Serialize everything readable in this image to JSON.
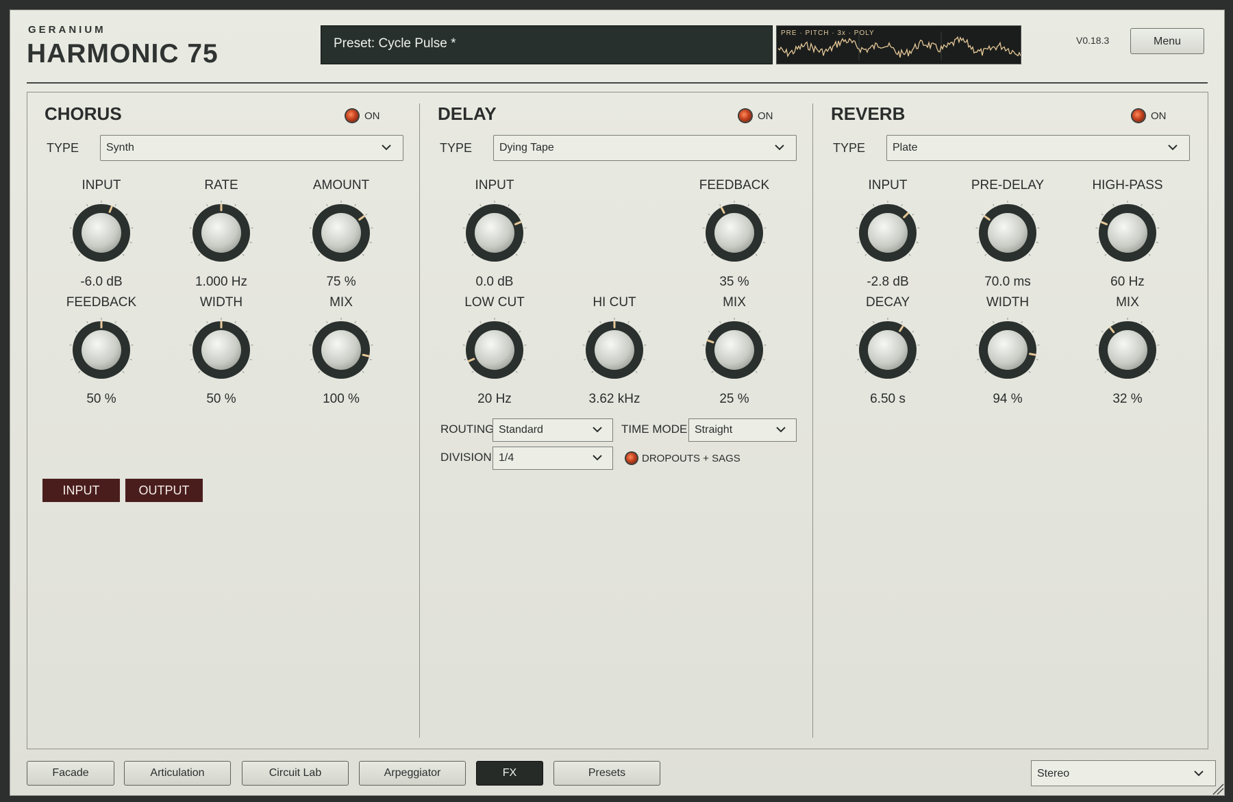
{
  "brand": {
    "maker": "GERANIUM",
    "product": "HARMONIC 75"
  },
  "preset": {
    "label": "Preset: Cycle Pulse *"
  },
  "scope": {
    "label": "PRE · PITCH · 3x · POLY",
    "line_color": "#e8c99a"
  },
  "version": "V0.18.3",
  "menu_label": "Menu",
  "accent_led": "#c4411f",
  "chorus": {
    "title": "CHORUS",
    "on_label": "ON",
    "type_label": "TYPE",
    "type_value": "Synth",
    "knobs": [
      {
        "label": "INPUT",
        "value": "-6.0 dB",
        "level": 0.58
      },
      {
        "label": "RATE",
        "value": "1.000 Hz",
        "level": 0.5
      },
      {
        "label": "AMOUNT",
        "value": "75 %",
        "level": 0.7
      },
      {
        "label": "FEEDBACK",
        "value": "50 %",
        "level": 0.5
      },
      {
        "label": "WIDTH",
        "value": "50 %",
        "level": 0.5
      },
      {
        "label": "MIX",
        "value": "100 %",
        "level": 0.88
      }
    ],
    "input_button": "INPUT",
    "output_button": "OUTPUT"
  },
  "delay": {
    "title": "DELAY",
    "on_label": "ON",
    "type_label": "TYPE",
    "type_value": "Dying Tape",
    "knobs": [
      {
        "label": "INPUT",
        "value": "0.0 dB",
        "level": 0.75
      },
      {
        "label": "FEEDBACK",
        "value": "35 %",
        "level": 0.4
      },
      {
        "label": "LOW CUT",
        "value": "20 Hz",
        "level": 0.08
      },
      {
        "label": "HI CUT",
        "value": "3.62 kHz",
        "level": 0.5
      },
      {
        "label": "MIX",
        "value": "25 %",
        "level": 0.24
      }
    ],
    "routing_label": "ROUTING",
    "routing_value": "Standard",
    "time_mode_label": "TIME MODE",
    "time_mode_value": "Straight",
    "division_label": "DIVISION",
    "division_value": "1/4",
    "dropouts_label": "DROPOUTS + SAGS"
  },
  "reverb": {
    "title": "REVERB",
    "on_label": "ON",
    "type_label": "TYPE",
    "type_value": "Plate",
    "knobs": [
      {
        "label": "INPUT",
        "value": "-2.8 dB",
        "level": 0.67
      },
      {
        "label": "PRE-DELAY",
        "value": "70.0 ms",
        "level": 0.3
      },
      {
        "label": "HIGH-PASS",
        "value": "60 Hz",
        "level": 0.25
      },
      {
        "label": "DECAY",
        "value": "6.50 s",
        "level": 0.62
      },
      {
        "label": "WIDTH",
        "value": "94 %",
        "level": 0.87
      },
      {
        "label": "MIX",
        "value": "32 %",
        "level": 0.36
      }
    ]
  },
  "tabs": [
    {
      "label": "Facade",
      "active": false
    },
    {
      "label": "Articulation",
      "active": false
    },
    {
      "label": "Circuit Lab",
      "active": false
    },
    {
      "label": "Arpeggiator",
      "active": false
    },
    {
      "label": "FX",
      "active": true
    },
    {
      "label": "Presets",
      "active": false
    }
  ],
  "output_mode": "Stereo"
}
